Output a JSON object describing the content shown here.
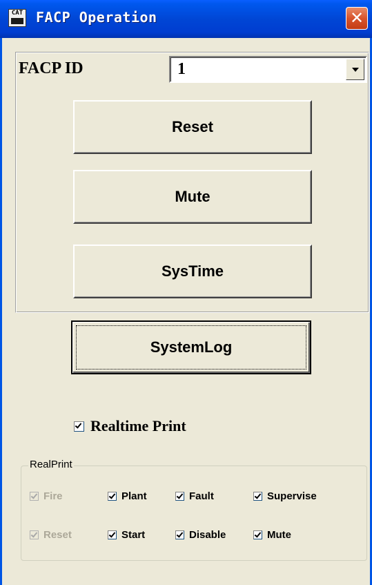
{
  "window": {
    "title": "FACP Operation",
    "icon_text": "CAT",
    "close_symbol": "✕"
  },
  "facp": {
    "label": "FACP ID",
    "selected_value": "1"
  },
  "buttons": {
    "reset": "Reset",
    "mute": "Mute",
    "systime": "SysTime",
    "systemlog": "SystemLog"
  },
  "realtime_print": {
    "label": "Realtime Print",
    "checked": true
  },
  "realprint": {
    "legend": "RealPrint",
    "row1": [
      {
        "label": "Fire",
        "checked": true,
        "enabled": false
      },
      {
        "label": "Plant",
        "checked": true,
        "enabled": true
      },
      {
        "label": "Fault",
        "checked": true,
        "enabled": true
      },
      {
        "label": "Supervise",
        "checked": true,
        "enabled": true
      }
    ],
    "row2": [
      {
        "label": "Reset",
        "checked": true,
        "enabled": false
      },
      {
        "label": "Start",
        "checked": true,
        "enabled": true
      },
      {
        "label": "Disable",
        "checked": true,
        "enabled": true
      },
      {
        "label": "Mute",
        "checked": true,
        "enabled": true
      }
    ]
  },
  "colors": {
    "titlebar": "#0046d5",
    "window_bg": "#ece9d8",
    "close": "#d8542c",
    "disabled_text": "#aca899"
  }
}
